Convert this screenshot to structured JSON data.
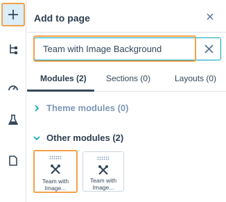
{
  "rail": {
    "items": [
      {
        "icon": "plus-icon"
      },
      {
        "icon": "tree-icon"
      },
      {
        "icon": "gauge-icon"
      },
      {
        "icon": "flask-icon"
      },
      {
        "icon": "page-icon"
      }
    ]
  },
  "panel": {
    "title": "Add to page",
    "close_icon": "close-icon"
  },
  "search": {
    "value": "Team with Image Background",
    "clear_icon": "close-icon"
  },
  "tabs": [
    {
      "label": "Modules (2)",
      "active": true
    },
    {
      "label": "Sections (0)",
      "active": false
    },
    {
      "label": "Layouts (0)",
      "active": false
    }
  ],
  "groups": {
    "theme": {
      "label": "Theme modules (0)",
      "expanded": false
    },
    "other": {
      "label": "Other modules (2)",
      "expanded": true
    }
  },
  "modules": [
    {
      "line1": "Team with",
      "line2": "Image...",
      "icon": "tools-icon",
      "highlighted": true
    },
    {
      "line1": "Team with",
      "line2": "Image...",
      "icon": "tools-icon",
      "highlighted": false
    }
  ],
  "colors": {
    "accent": "#00a4bd",
    "highlight": "#f5a04a",
    "text": "#33475b",
    "muted": "#7c98b6",
    "rail_active_bg": "#d9eef7"
  }
}
